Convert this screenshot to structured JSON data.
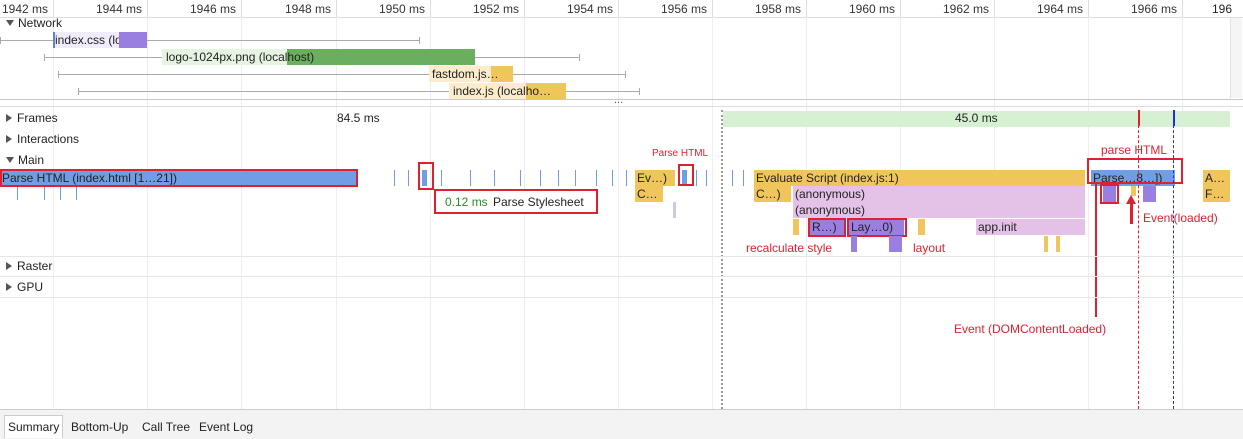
{
  "ruler": {
    "ticks": [
      "1942 ms",
      "1944 ms",
      "1946 ms",
      "1948 ms",
      "1950 ms",
      "1952 ms",
      "1954 ms",
      "1956 ms",
      "1958 ms",
      "1960 ms",
      "1962 ms",
      "1964 ms",
      "1966 ms",
      "196"
    ]
  },
  "network": {
    "label": "Network",
    "requests": [
      "index.css (lo…",
      "logo-1024px.png (localhost)",
      "fastdom.js…",
      "index.js (localho…"
    ]
  },
  "overflow_dots": "...",
  "tracks": {
    "frames": "Frames",
    "interactions": "Interactions",
    "main": "Main",
    "raster": "Raster",
    "gpu": "GPU"
  },
  "frames": {
    "frame1": "84.5 ms",
    "frame2": "45.0 ms"
  },
  "main": {
    "parse_html": "Parse HTML (index.html [1…21])",
    "ev_short": "Ev…)",
    "c_short": "C…",
    "evaluate_script": "Evaluate Script (index.js:1)",
    "c_paren": "C…)",
    "anonymous1": "(anonymous)",
    "anonymous2": "(anonymous)",
    "recalc_short": "R…)",
    "layout_short": "Lay…0)",
    "app_init": "app.init",
    "parse_b": "Parse…8…])",
    "a_short": "A…",
    "f_short": "F…"
  },
  "tooltip": {
    "duration": "0.12 ms",
    "name": "Parse Stylesheet"
  },
  "annotations": {
    "parse_html_small": "Parse HTML",
    "parse_html_big": "parse HTML",
    "recalculate_style": "recalculate style",
    "layout": "layout",
    "event_loaded": "Event(loaded)",
    "event_dcl": "Event (DOMContentLoaded)"
  },
  "bottom_tabs": [
    "Summary",
    "Bottom-Up",
    "Call Tree",
    "Event Log"
  ],
  "colors": {
    "scripting": "#f0c55c",
    "loading": "#6f9ee6",
    "rendering": "#9b7fe0",
    "anonymous": "#e4c2e8",
    "frame": "#d7efd2",
    "network_image": "#6aaf5e",
    "annotation": "#e02030"
  }
}
